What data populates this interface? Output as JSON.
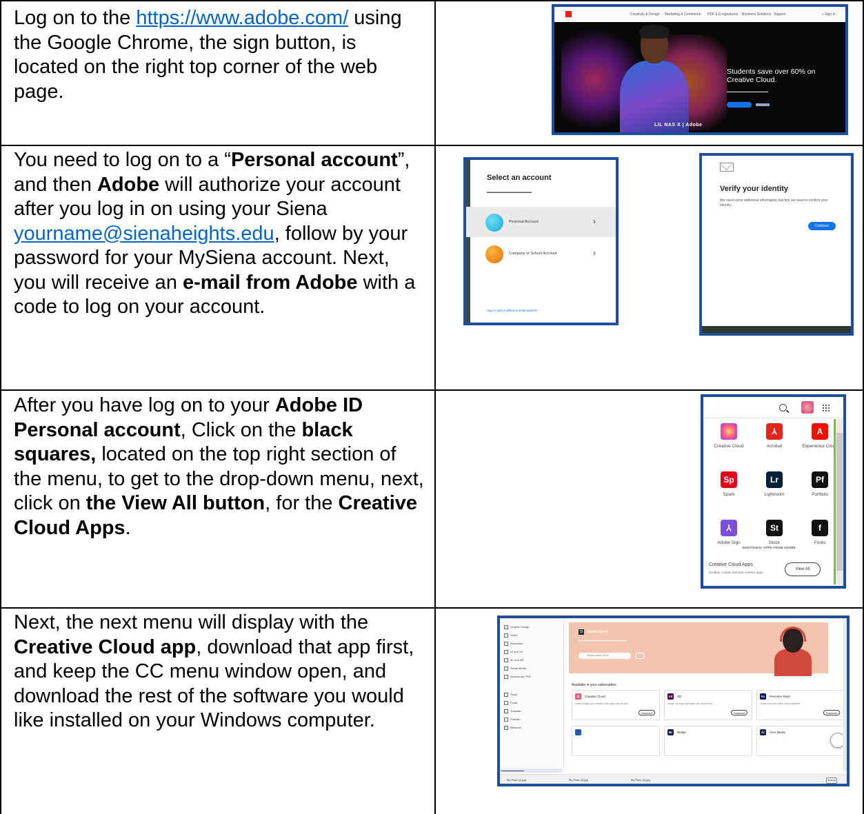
{
  "rows": [
    {
      "text_parts": [
        {
          "t": "Log on to the ",
          "b": false
        },
        {
          "t": "https://www.adobe.com/",
          "link": true
        },
        {
          "t": " using the Google Chrome, the sign button, is located on the right top corner of the web page.",
          "b": false
        }
      ]
    },
    {
      "text_parts": [
        {
          "t": "You need to log on to a “",
          "b": false
        },
        {
          "t": "Personal account",
          "b": true
        },
        {
          "t": "”, and then ",
          "b": false
        },
        {
          "t": "Adobe",
          "b": true
        },
        {
          "t": " will authorize your account after you log in on using your Siena ",
          "b": false
        },
        {
          "t": "yourname@sienaheights.edu",
          "link": true
        },
        {
          "t": ", follow by your password for your MySiena account.  Next, you will receive an ",
          "b": false
        },
        {
          "t": "e-mail from Adobe",
          "b": true
        },
        {
          "t": " with a code to log on your account.",
          "b": false
        }
      ]
    },
    {
      "text_parts": [
        {
          "t": "After you have log on to your ",
          "b": false
        },
        {
          "t": "Adobe ID Personal account",
          "b": true
        },
        {
          "t": ", Click on the ",
          "b": false
        },
        {
          "t": "black squares,",
          "b": true
        },
        {
          "t": " located on the top right section of the menu, to get to the drop-down menu, next, click on  ",
          "b": false
        },
        {
          "t": "the View All button",
          "b": true
        },
        {
          "t": ", for the ",
          "b": false
        },
        {
          "t": "Creative Cloud Apps",
          "b": true
        },
        {
          "t": ".",
          "b": false
        }
      ]
    },
    {
      "text_parts": [
        {
          "t": "Next, the next menu will display with the ",
          "b": false
        },
        {
          "t": "Creative Cloud app",
          "b": true
        },
        {
          "t": ", download that app first, and keep the CC menu window open, and download the rest of the software you would like installed on your Windows computer.",
          "b": false
        }
      ]
    }
  ],
  "shot1": {
    "headline": "Students save over 60% on Creative Cloud.",
    "brand": "LIL NAS X  |  Adobe"
  },
  "shot2a": {
    "title": "Select an account",
    "accounts": [
      "Personal Account",
      "Company or School Account"
    ],
    "signin_other": "Sign in with a different email address"
  },
  "shot2b": {
    "title": "Verify your identity",
    "body": "We need some additional information, but first we need to confirm your identity.",
    "continue": "Continue"
  },
  "shot3": {
    "apps": [
      {
        "label": "Creative Cloud",
        "glyph": "",
        "color": "#e8477e"
      },
      {
        "label": "Acrobat",
        "glyph": "⅄",
        "color": "#e1251b"
      },
      {
        "label": "Experience Cloud",
        "glyph": "A",
        "color": "#eb1000"
      },
      {
        "label": "Spark",
        "glyph": "Sp",
        "color": "#e0001a"
      },
      {
        "label": "Lightroom",
        "glyph": "Lr",
        "color": "#001e36"
      },
      {
        "label": "Portfolio",
        "glyph": "Pf",
        "color": "#111111"
      },
      {
        "label": "Adobe Sign",
        "glyph": "⅄",
        "color": "#7b4fd6"
      },
      {
        "label": "Stock",
        "glyph": "St",
        "color": "#111111"
      },
      {
        "label": "Fonts",
        "glyph": "f",
        "color": "#111111"
      }
    ],
    "additional": "ADDITIONAL APPS FROM ADOBE",
    "cc_apps": "Creative Cloud Apps",
    "cc_apps_sub": "Desktop, mobile and web creative apps",
    "view_all": "View All"
  },
  "shot4": {
    "sidebar": [
      "Graphic Design",
      "Video",
      "Illustration",
      "UI and UX",
      "3D and AR",
      "Social Media",
      "Acrobat and PDF",
      "Stock",
      "Fonts",
      "Tutorials",
      "Portfolio",
      "Behance"
    ],
    "stock_title": "Adobe Stock",
    "search_placeholder": "Search Adobe Stock",
    "available": "Available in your subscription",
    "cards": [
      {
        "name": "Creative Cloud",
        "glyph": "",
        "color": "#e8477e",
        "desc": "Easily manage your Creative Cloud apps and services",
        "btn": "Download"
      },
      {
        "name": "XD",
        "glyph": "Xd",
        "color": "#470137",
        "desc": "Design, prototype and share user experiences",
        "btn": "Download"
      },
      {
        "name": "Premiere Rush",
        "glyph": "Ru",
        "color": "#00005b",
        "desc": "Create and share online videos anywhere",
        "btn": "Download"
      },
      {
        "name": "",
        "glyph": "",
        "color": "#2a5aa8",
        "desc": "",
        "btn": ""
      },
      {
        "name": "Bridge",
        "glyph": "Br",
        "color": "#1c1c4e",
        "desc": "",
        "btn": ""
      },
      {
        "name": "Aero (Beta)",
        "glyph": "Ar",
        "color": "#1c1c4e",
        "desc": "",
        "btn": ""
      }
    ],
    "downloads": [
      "My Pass (1).jpg",
      "My Pass (2).jpg",
      "My Pass (3).jpg"
    ],
    "show_all": "Show all"
  }
}
